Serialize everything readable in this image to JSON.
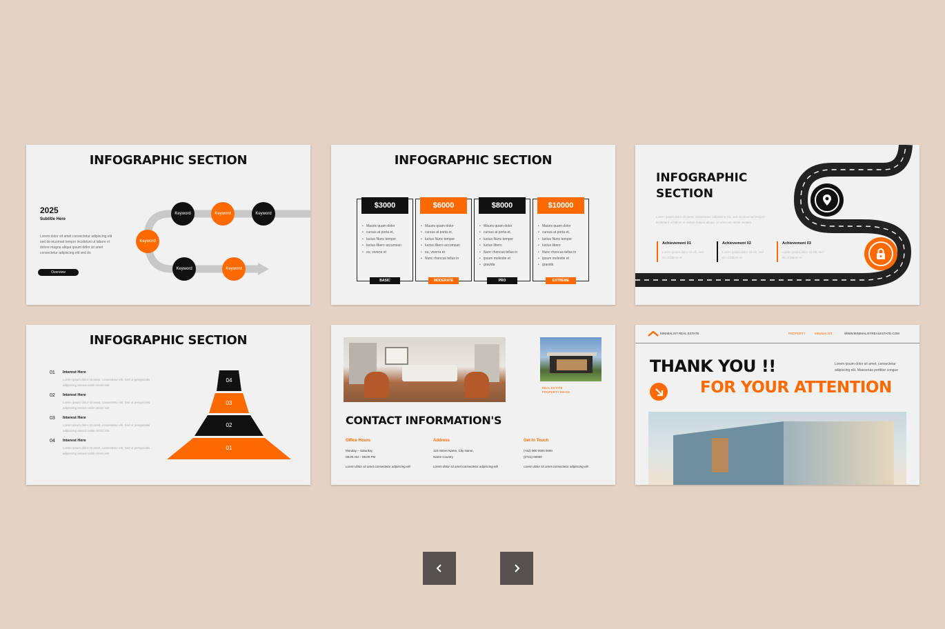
{
  "slides": {
    "s1": {
      "title": "INFOGRAPHIC SECTION",
      "year": "2025",
      "subtitle": "Subtitle Here",
      "body": "Lorem dolor sit amet consectetur adipiscing elit sed do eiusmod tempor incididunt ut labore et dolore magna aliqua ipsum dolor sit amet consectetur adipiscing elit sed do",
      "button": "Overview",
      "keywords": [
        "Keyword",
        "Keyword",
        "Keyword",
        "Keyword",
        "Keyword",
        "Keyword"
      ]
    },
    "s2": {
      "title": "INFOGRAPHIC SECTION",
      "plans": [
        {
          "price": "$3000",
          "tier": "BASIC",
          "lines": [
            "Mauris quam dolor",
            "cursus at porta et,",
            "luctus Nunc tempor",
            "luctus libero accumsan",
            "eu, viverra et"
          ]
        },
        {
          "price": "$6000",
          "tier": "MODERATE",
          "lines": [
            "Mauris quam dolor",
            "cursus at porta et,",
            "luctus Nunc tempor",
            "luctus libero accumsan",
            "eu, viverra et",
            "Nunc rhoncus tellus in"
          ]
        },
        {
          "price": "$8000",
          "tier": "PRO",
          "lines": [
            "Mauris quam dolor",
            "cursus at porta et,",
            "luctus Nunc tempor",
            "luctus libero",
            "Nunc rhoncus tellus in",
            "ipsum molestie et",
            "gravida"
          ]
        },
        {
          "price": "$10000",
          "tier": "EXTREME",
          "lines": [
            "Mauris quam dolor",
            "cursus at porta et,",
            "luctus Nunc tempor",
            "luctus libero",
            "Nunc rhoncus tellus in",
            "ipsum molestie et",
            "gravida"
          ]
        }
      ]
    },
    "s3": {
      "title_line1": "INFOGRAPHIC",
      "title_line2": "SECTION",
      "body": "Lorem ipsum dolor sit amet, consectetur adipiscing elit, sed do eiusmod tempor incididunt ut labore et dolore magna aliqua. Ut enim ad minim veniam",
      "achievements": [
        {
          "label": "Achievement 01",
          "text": "Lorem ipsum dolor sit elit, sed do ut labore et"
        },
        {
          "label": "Achievement 02",
          "text": "Lorem ipsum dolor sit elit, sed do ut labore et"
        },
        {
          "label": "Achievement 03",
          "text": "Lorem ipsum dolor sit elit, sed do ut labore et"
        }
      ]
    },
    "s4": {
      "title": "INFOGRAPHIC SECTION",
      "items": [
        {
          "num": "01",
          "label": "Interest Here",
          "text": "Lorem ipsum dolor sit amet, consectetur elit. Sed ut perspiciatis adipiscing amous unde omnis iste"
        },
        {
          "num": "02",
          "label": "Interest Here",
          "text": "Lorem ipsum dolor sit amet, consectetur elit. Sed ut perspiciatis adipiscing amous unde omnis iste"
        },
        {
          "num": "03",
          "label": "Interest Here",
          "text": "Lorem ipsum dolor sit amet, consectetur elit. Sed ut perspiciatis adipiscing amous unde omnis iste"
        },
        {
          "num": "04",
          "label": "Interest Here",
          "text": "Lorem ipsum dolor sit amet, consectetur elit. Sed ut perspiciatis adipiscing amous unde omnis iste"
        }
      ],
      "pyramid": [
        "04",
        "03",
        "02",
        "01"
      ]
    },
    "s5": {
      "title": "CONTACT INFORMATION'S",
      "image_caption_1": "REAL ESTATE",
      "image_caption_2": "PROPERTY IMAGE",
      "cols": [
        {
          "head": "Office Hours",
          "l1": "Monday – Saturday",
          "l2": "08.00 AM – 08.00 PM",
          "foot": "Lorem dolor sit amet consectetur adipiscing elit"
        },
        {
          "head": "Address",
          "l1": "123 Street Name, City Name,",
          "l2": "Name Country",
          "foot": "Lorem dolor sit amet consectetur adipiscing elit"
        },
        {
          "head": "Get In Touch",
          "l1": "(+62) 000 0000 0000",
          "l2": "(0721) 00000",
          "foot": "Lorem dolor sit amet consectetur adipiscing elit"
        }
      ]
    },
    "s6": {
      "brand": "MINIMALIST REAL ESTATE",
      "nav1": "PROPERTY",
      "nav2": "MINIMALIST",
      "url": "WWW.MINIMALISTREALESTATE.COM",
      "thanks": "THANK YOU !!",
      "attention": "FOR YOUR ATTENTION",
      "side_text": "Lorem ipsum dolor sit amet, consectetur adipiscing elit. Maecenas porttitor congue"
    }
  },
  "nav": {
    "prev_icon": "chevron-left-icon",
    "next_icon": "chevron-right-icon"
  },
  "colors": {
    "accent": "#ff6a00",
    "dark": "#111111",
    "background": "#e4d2c4"
  }
}
